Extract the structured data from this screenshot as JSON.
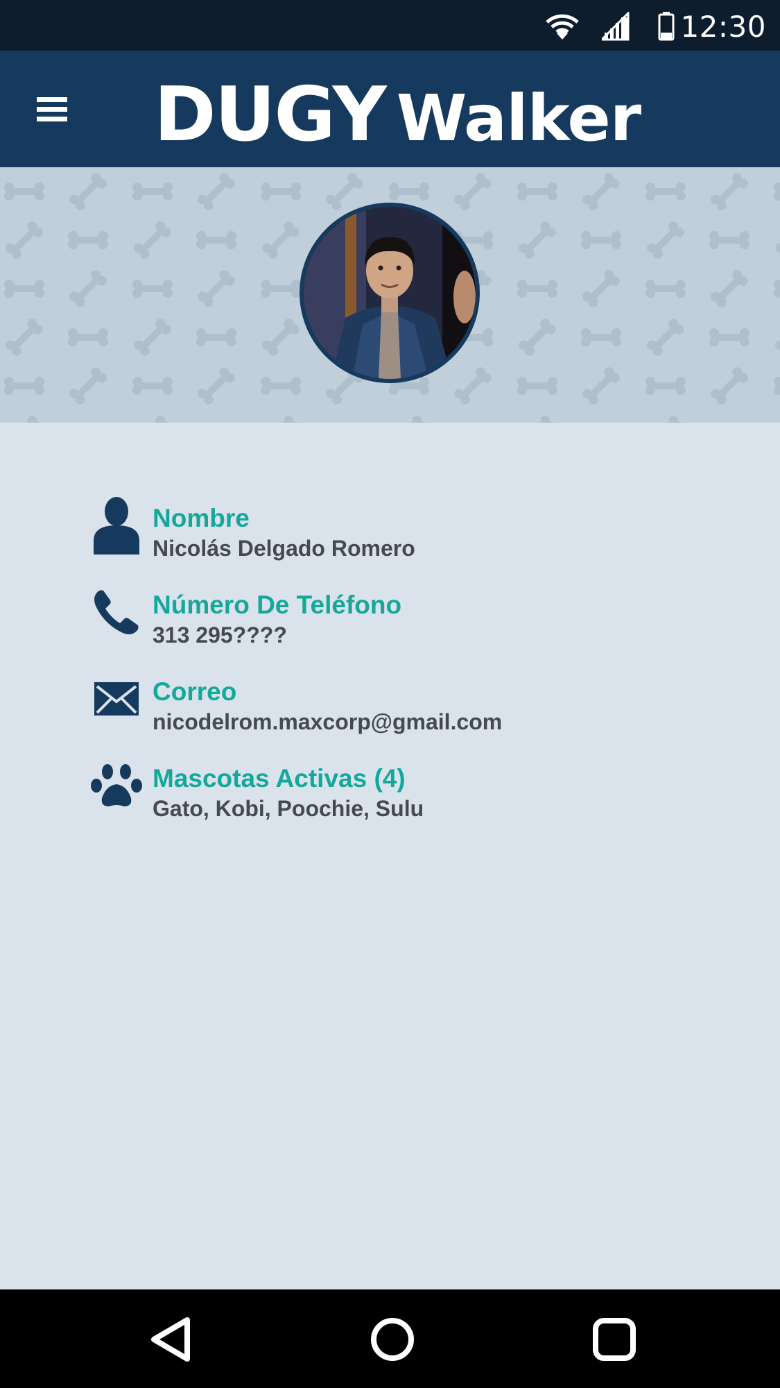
{
  "status_bar": {
    "time": "12:30",
    "icons": [
      "wifi-icon",
      "cell-signal-icon",
      "battery-icon"
    ],
    "color": "#0d1d2d"
  },
  "app_bar": {
    "logo_part1": "DUGY",
    "logo_part2": "Walker",
    "menu_icon": "hamburger-menu-icon",
    "color": "#153a5e"
  },
  "profile": {
    "banner_pattern": "bone-pattern",
    "avatar": "profile-photo"
  },
  "info": {
    "name": {
      "label": "Nombre",
      "value": "Nicolás Delgado Romero",
      "icon": "person-icon"
    },
    "phone": {
      "label": "Número De Teléfono",
      "value": "313 295????",
      "icon": "phone-icon"
    },
    "email": {
      "label": "Correo",
      "value": "nicodelrom.maxcorp@gmail.com",
      "icon": "envelope-icon"
    },
    "pets": {
      "label": "Mascotas Activas (4)",
      "value": "Gato, Kobi, Poochie, Sulu",
      "icon": "paw-icon"
    }
  },
  "nav_bar": {
    "buttons": [
      "back-icon",
      "home-icon",
      "recents-icon"
    ]
  },
  "colors": {
    "accent": "#14a89a",
    "primary": "#153a5e",
    "text": "#454a50",
    "background": "#dae3eb"
  }
}
